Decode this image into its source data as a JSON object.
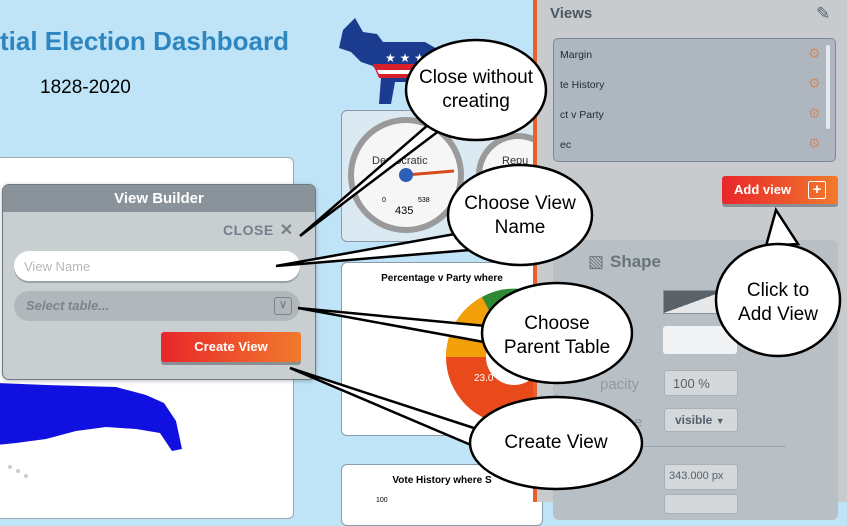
{
  "dashboard": {
    "title": "tial Election Dashboard",
    "subtitle": "1828-2020",
    "gauge_label": "Democratic",
    "gauge_label_right": "Repu",
    "gauge_ticks": [
      "0",
      "435",
      "538"
    ],
    "gauge_value": "435",
    "pie_card_title": "Percentage v Party where",
    "pie_value": "23.0",
    "vote_card_title": "Vote History where S",
    "vote_axis": "100"
  },
  "panel": {
    "title": "Views",
    "views": [
      {
        "label": "Margin"
      },
      {
        "label": "te History"
      },
      {
        "label": "ct v Party"
      },
      {
        "label": "ec"
      }
    ],
    "add_view_label": "Add view",
    "shape": {
      "title": "Shape",
      "opacity_label": "pacity",
      "opacity_value": "100 %",
      "visibility_label": "e",
      "visibility_value": "visible",
      "width_value": "343.000 px"
    }
  },
  "view_builder": {
    "title": "View Builder",
    "close_label": "CLOSE",
    "view_name_placeholder": "View Name",
    "select_table_placeholder": "Select table...",
    "create_label": "Create View"
  },
  "callouts": {
    "close": [
      "Close without",
      "creating"
    ],
    "name": [
      "Choose View",
      "Name"
    ],
    "parent": [
      "Choose",
      "Parent  Table"
    ],
    "create": "Create  View",
    "add": [
      "Click to",
      "Add View"
    ]
  },
  "colors": {
    "accent": "#e8612c",
    "button_start": "#e8262b",
    "button_end": "#f27a2c",
    "title_blue": "#2e86c1",
    "background": "#bfe3f7"
  }
}
